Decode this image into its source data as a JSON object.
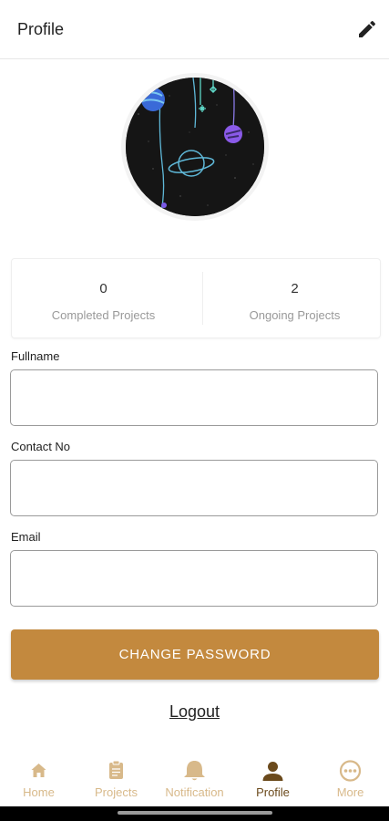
{
  "header": {
    "title": "Profile",
    "edit_icon": "pencil-icon"
  },
  "stats": [
    {
      "value": "0",
      "label": "Completed Projects"
    },
    {
      "value": "2",
      "label": "Ongoing Projects"
    }
  ],
  "form": {
    "fullname_label": "Fullname",
    "fullname_value": "",
    "contact_label": "Contact No",
    "contact_value": "",
    "email_label": "Email",
    "email_value": ""
  },
  "actions": {
    "change_password": "CHANGE PASSWORD",
    "logout": "Logout"
  },
  "nav": {
    "home": "Home",
    "projects": "Projects",
    "notification": "Notification",
    "profile": "Profile",
    "more": "More",
    "active": "profile"
  },
  "colors": {
    "accent": "#c3893e",
    "nav_inactive": "#d8b98a",
    "nav_active": "#6b4a1c"
  }
}
